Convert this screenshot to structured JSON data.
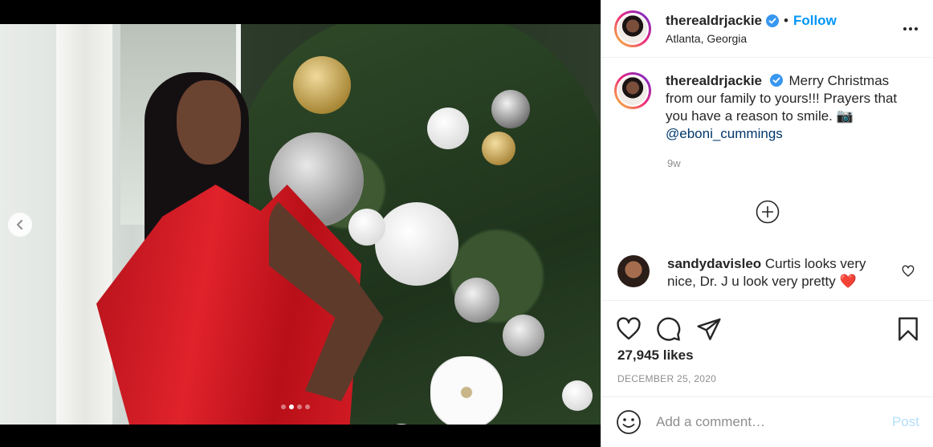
{
  "post": {
    "username": "therealdrjackie",
    "follow_label": "Follow",
    "location": "Atlanta, Georgia",
    "caption_text": "Merry Christmas from our family to yours!!! Prayers that you have a reason to smile. 📷",
    "caption_mention": "@eboni_cummings",
    "time_ago": "9w",
    "likes": "27,945 likes",
    "date": "DECEMBER 25, 2020"
  },
  "comment": {
    "username": "sandydavisleo",
    "text": "Curtis looks very nice, Dr. J u look very pretty",
    "emoji": "❤️"
  },
  "composer": {
    "placeholder": "Add a comment…",
    "post_label": "Post"
  },
  "carousel": {
    "total": 4,
    "active_index": 1
  },
  "icons": [
    "verified-icon",
    "more-icon",
    "add-icon",
    "heart-icon",
    "comment-icon",
    "share-icon",
    "save-icon",
    "emoji-icon",
    "chevron-left-icon"
  ],
  "colors": {
    "follow": "#0095f6",
    "mention": "#00376b",
    "post_disabled": "#b2dffc",
    "verified": "#3897f0"
  }
}
